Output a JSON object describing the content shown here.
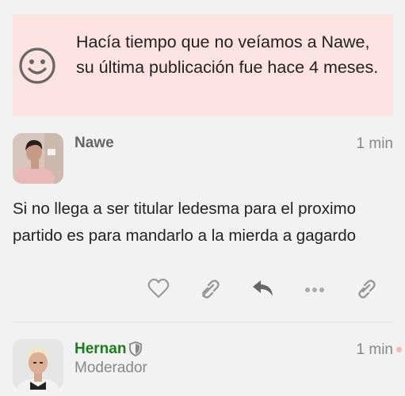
{
  "notice": {
    "message": "Hacía tiempo que no veíamos a Nawe, su última publicación fue hace 4 meses.",
    "icon": "smile-icon",
    "background_color": "#fde2e2"
  },
  "posts": [
    {
      "username": "Nawe",
      "timestamp": "1 min",
      "body": "Si no llega a ser titular ledesma para el proximo partido es para mandarlo a la mierda a gagardo",
      "actions": [
        "heart-icon",
        "link-icon",
        "reply-icon",
        "more-icon",
        "link-icon"
      ]
    },
    {
      "username": "Hernan",
      "username_color": "#1a7f1a",
      "role": "Moderador",
      "timestamp": "1 min",
      "badge_icon": "shield-icon"
    }
  ]
}
